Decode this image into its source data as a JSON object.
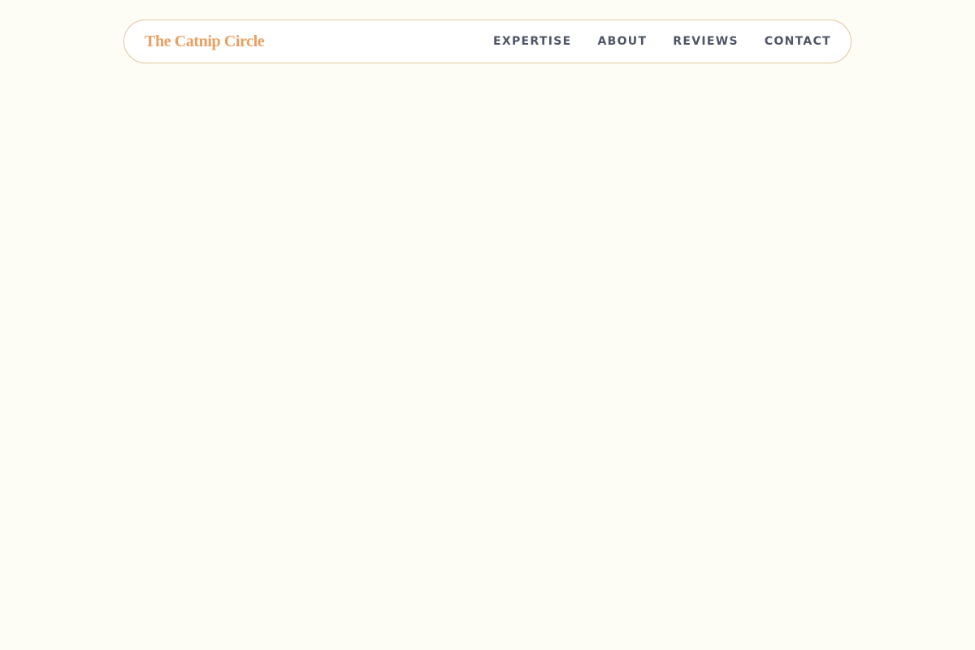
{
  "header": {
    "brand": "The Catnip Circle",
    "nav": [
      {
        "label": "EXPERTISE"
      },
      {
        "label": "ABOUT"
      },
      {
        "label": "REVIEWS"
      },
      {
        "label": "CONTACT"
      }
    ]
  },
  "colors": {
    "background": "#fdfcf5",
    "brand": "#e8a060",
    "nav_text": "#4d5566",
    "nav_border": "#e2c5a0"
  }
}
